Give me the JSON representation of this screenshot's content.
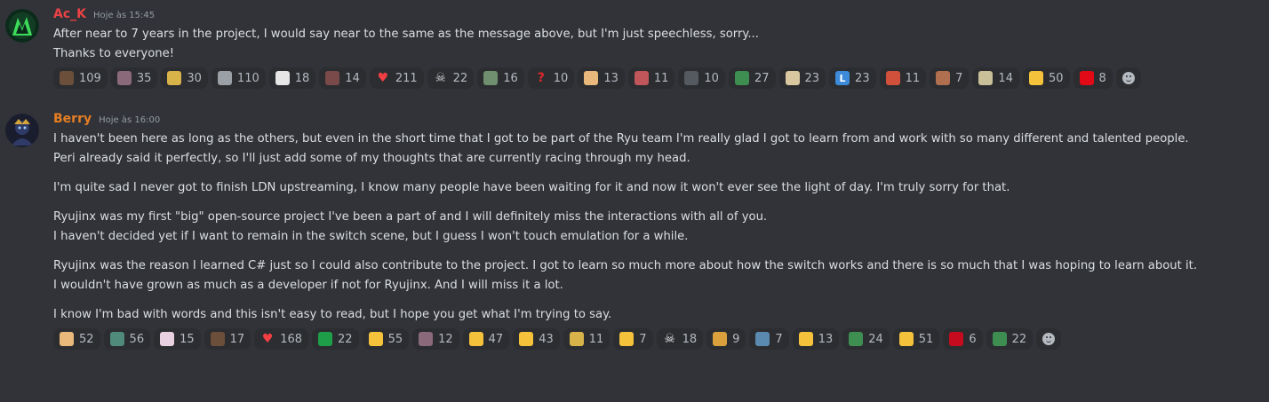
{
  "messages": [
    {
      "author": "Ac_K",
      "author_color": "#ed4245",
      "timestamp": "Hoje às 15:45",
      "lines": [
        "After near to 7 years in the project, I would say near to the same as the message above, but I'm just speechless, sorry...",
        "Thanks to everyone!"
      ],
      "reactions": [
        {
          "icon": "custom-emoji-person-icon",
          "color": "#6b4f3a",
          "count": "109"
        },
        {
          "icon": "custom-emoji-person-icon",
          "color": "#8a6a7a",
          "count": "35"
        },
        {
          "icon": "custom-emoji-banana-icon",
          "color": "#d8b34a",
          "count": "30"
        },
        {
          "icon": "custom-emoji-image-icon",
          "color": "#9aa0a6",
          "count": "110"
        },
        {
          "icon": "custom-emoji-penguin-icon",
          "color": "#e6e6e6",
          "count": "18"
        },
        {
          "icon": "custom-emoji-face-icon",
          "color": "#7a4a4a",
          "count": "14"
        },
        {
          "icon": "red-heart-icon",
          "color": "#f23f43",
          "count": "211"
        },
        {
          "icon": "skull-crossbones-icon",
          "color": "#d0d0d0",
          "count": "22"
        },
        {
          "icon": "custom-emoji-face-icon",
          "color": "#6f8f6f",
          "count": "16"
        },
        {
          "icon": "question-mark-icon",
          "color": "#e0282b",
          "count": "10"
        },
        {
          "icon": "bread-icon",
          "color": "#e8b97a",
          "count": "13"
        },
        {
          "icon": "custom-emoji-box-icon",
          "color": "#c0555a",
          "count": "11"
        },
        {
          "icon": "custom-emoji-person-icon",
          "color": "#555a60",
          "count": "10"
        },
        {
          "icon": "custom-emoji-frog-icon",
          "color": "#3e8e52",
          "count": "27"
        },
        {
          "icon": "custom-emoji-face-icon",
          "color": "#d9c7a0",
          "count": "23"
        },
        {
          "icon": "letter-l-icon",
          "color": "#3c8ad8",
          "count": "23"
        },
        {
          "icon": "custom-emoji-face-icon",
          "color": "#d0503c",
          "count": "11"
        },
        {
          "icon": "custom-emoji-person-icon",
          "color": "#b07050",
          "count": "7"
        },
        {
          "icon": "custom-emoji-crab-icon",
          "color": "#c9c09a",
          "count": "14"
        },
        {
          "icon": "cool-face-icon",
          "color": "#f5c23b",
          "count": "50"
        },
        {
          "icon": "turkey-flag-icon",
          "color": "#e30a17",
          "count": "8"
        }
      ]
    },
    {
      "author": "Berry",
      "author_color": "#e67e22",
      "timestamp": "Hoje às 16:00",
      "paragraphs": [
        [
          "I haven't been here as long as the others, but even in the short time that I got to be part of the Ryu team I'm really glad I got to learn from and work with so many different and talented people.",
          "Peri already said it perfectly, so I'll just add some of my thoughts that are currently racing through my head."
        ],
        [
          "I'm quite sad I never got to finish LDN upstreaming, I know many people have been waiting for it and now it won't ever see the light of day. I'm truly sorry for that."
        ],
        [
          "Ryujinx was my first \"big\" open-source project I've been a part of and I will definitely miss the interactions with all of you.",
          "I haven't decided yet if I want to remain in the switch scene, but I guess I won't touch emulation for a while."
        ],
        [
          "Ryujinx was the reason I learned C# just so I could also contribute to the project. I got to learn so much more about how the switch works and there is so much that I was hoping to learn about it.",
          "I wouldn't have grown as much as a developer if not for Ryujinx. And I will miss it a lot."
        ],
        [
          "I know I'm bad with words and this isn't easy to read, but I hope you get what I'm trying to say."
        ]
      ],
      "reactions": [
        {
          "icon": "bread-icon",
          "color": "#e8b97a",
          "count": "52"
        },
        {
          "icon": "custom-emoji-boat-icon",
          "color": "#4f8a7a",
          "count": "56"
        },
        {
          "icon": "custom-emoji-face-icon",
          "color": "#e8d0e0",
          "count": "15"
        },
        {
          "icon": "custom-emoji-person-icon",
          "color": "#6b4f3a",
          "count": "17"
        },
        {
          "icon": "red-heart-icon",
          "color": "#f23f43",
          "count": "168"
        },
        {
          "icon": "brazil-flag-icon",
          "color": "#1f9e4a",
          "count": "22"
        },
        {
          "icon": "pleading-face-icon",
          "color": "#f5c23b",
          "count": "55"
        },
        {
          "icon": "custom-emoji-person-icon",
          "color": "#8a6a7a",
          "count": "12"
        },
        {
          "icon": "smiling-cat-icon",
          "color": "#f5c23b",
          "count": "47"
        },
        {
          "icon": "thinking-face-icon",
          "color": "#f5c23b",
          "count": "43"
        },
        {
          "icon": "custom-emoji-banana-icon",
          "color": "#d8b34a",
          "count": "11"
        },
        {
          "icon": "cat-face-icon",
          "color": "#f5c23b",
          "count": "7"
        },
        {
          "icon": "skull-icon",
          "color": "#e6e6e6",
          "count": "18"
        },
        {
          "icon": "cat-icon",
          "color": "#d9a03b",
          "count": "9"
        },
        {
          "icon": "custom-emoji-shark-icon",
          "color": "#5a8ab0",
          "count": "7"
        },
        {
          "icon": "weary-cat-icon",
          "color": "#f5c23b",
          "count": "13"
        },
        {
          "icon": "custom-emoji-frog-icon",
          "color": "#3e8e52",
          "count": "24"
        },
        {
          "icon": "crying-face-icon",
          "color": "#f5c23b",
          "count": "51"
        },
        {
          "icon": "spain-flag-icon",
          "color": "#c60b1e",
          "count": "6"
        },
        {
          "icon": "custom-emoji-frog-icon",
          "color": "#3e8e52",
          "count": "22"
        }
      ]
    }
  ]
}
